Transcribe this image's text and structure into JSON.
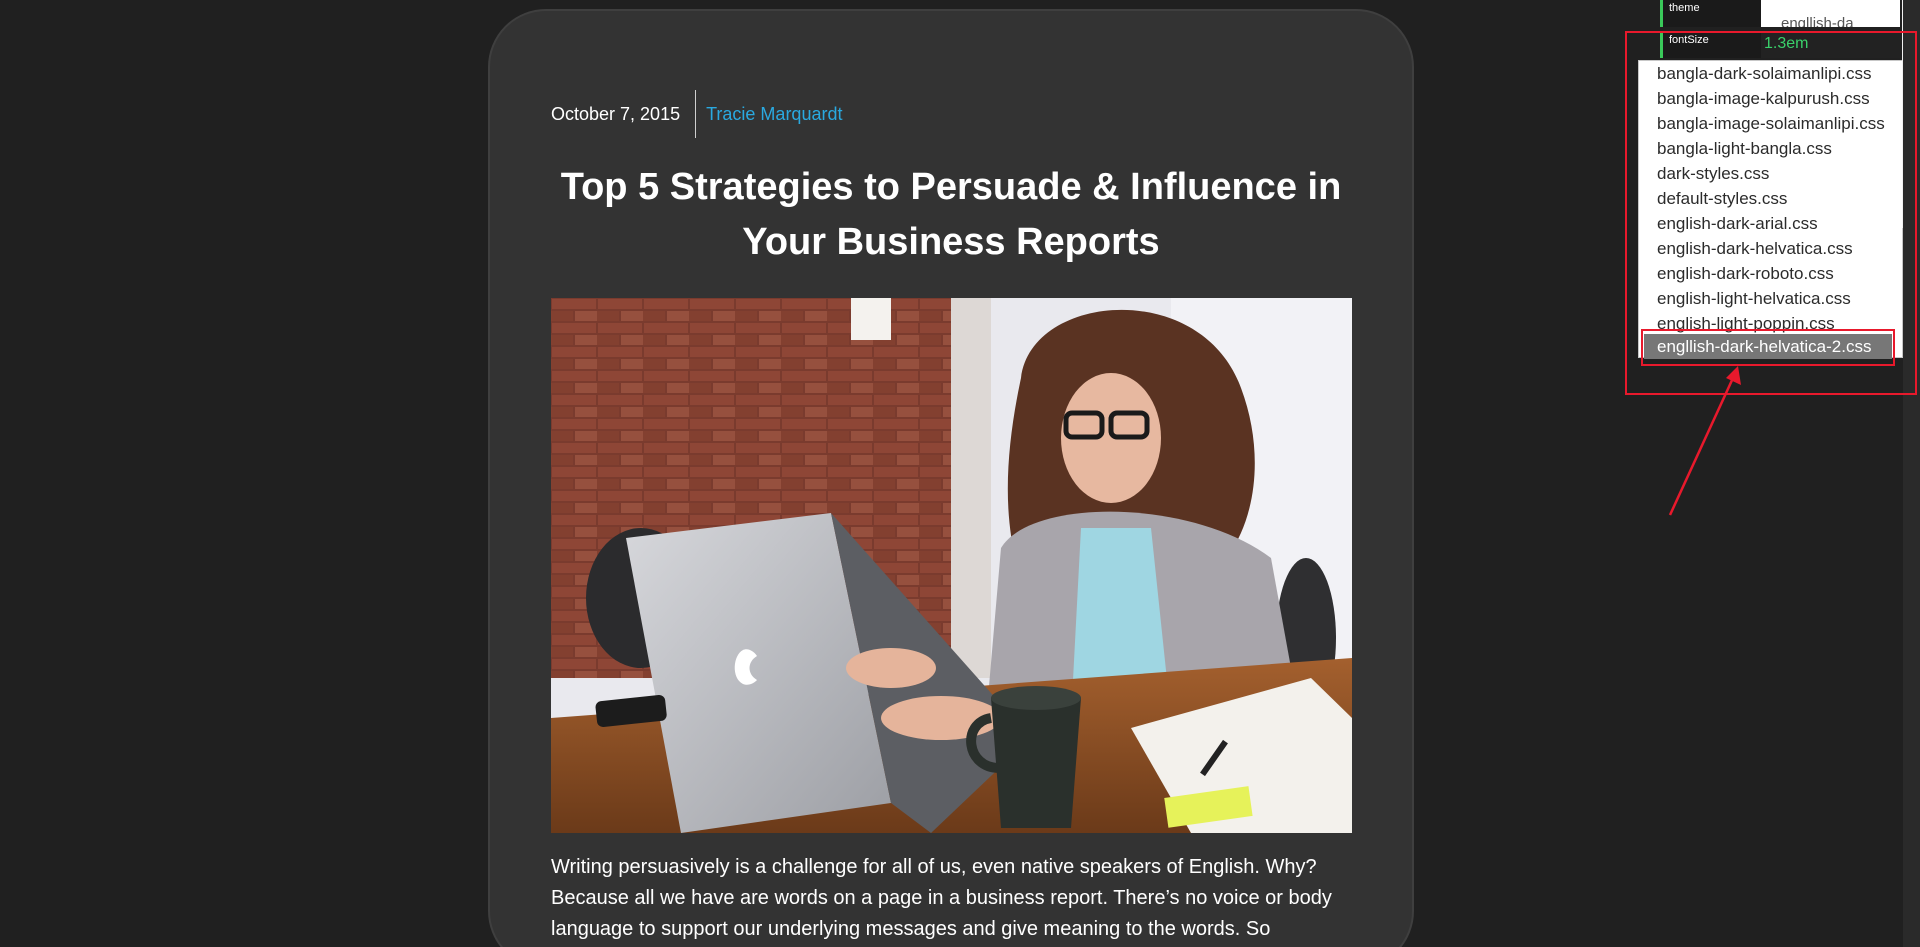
{
  "article": {
    "date": "October 7, 2015",
    "author": "Tracie Marquardt",
    "title": "Top 5 Strategies to Persuade & Influence in Your Business Reports",
    "body": "Writing persuasively is a challenge for all of us, even native speakers of English. Why? Because all we have are words on a page in a business report. There’s no voice or body language to support our underlying messages and give meaning to the words. So"
  },
  "config_panel": {
    "theme_label": "theme",
    "theme_value": "engllish-da",
    "font_size_label": "fontSize",
    "font_size_value": "1.3em"
  },
  "dropdown": {
    "options": [
      "bangla-dark-solaimanlipi.css",
      "bangla-image-kalpurush.css",
      "bangla-image-solaimanlipi.css",
      "bangla-light-bangla.css",
      "dark-styles.css",
      "default-styles.css",
      "english-dark-arial.css",
      "english-dark-helvatica.css",
      "english-dark-roboto.css",
      "english-light-helvatica.css",
      "english-light-poppin.css",
      "engllish-dark-helvatica-2.css"
    ],
    "selected_index": 11
  },
  "colors": {
    "background": "#202020",
    "card": "#333333",
    "accent_link": "#2aa9e0",
    "annotation": "#e8192c",
    "font_size_value": "#3ad06a"
  }
}
